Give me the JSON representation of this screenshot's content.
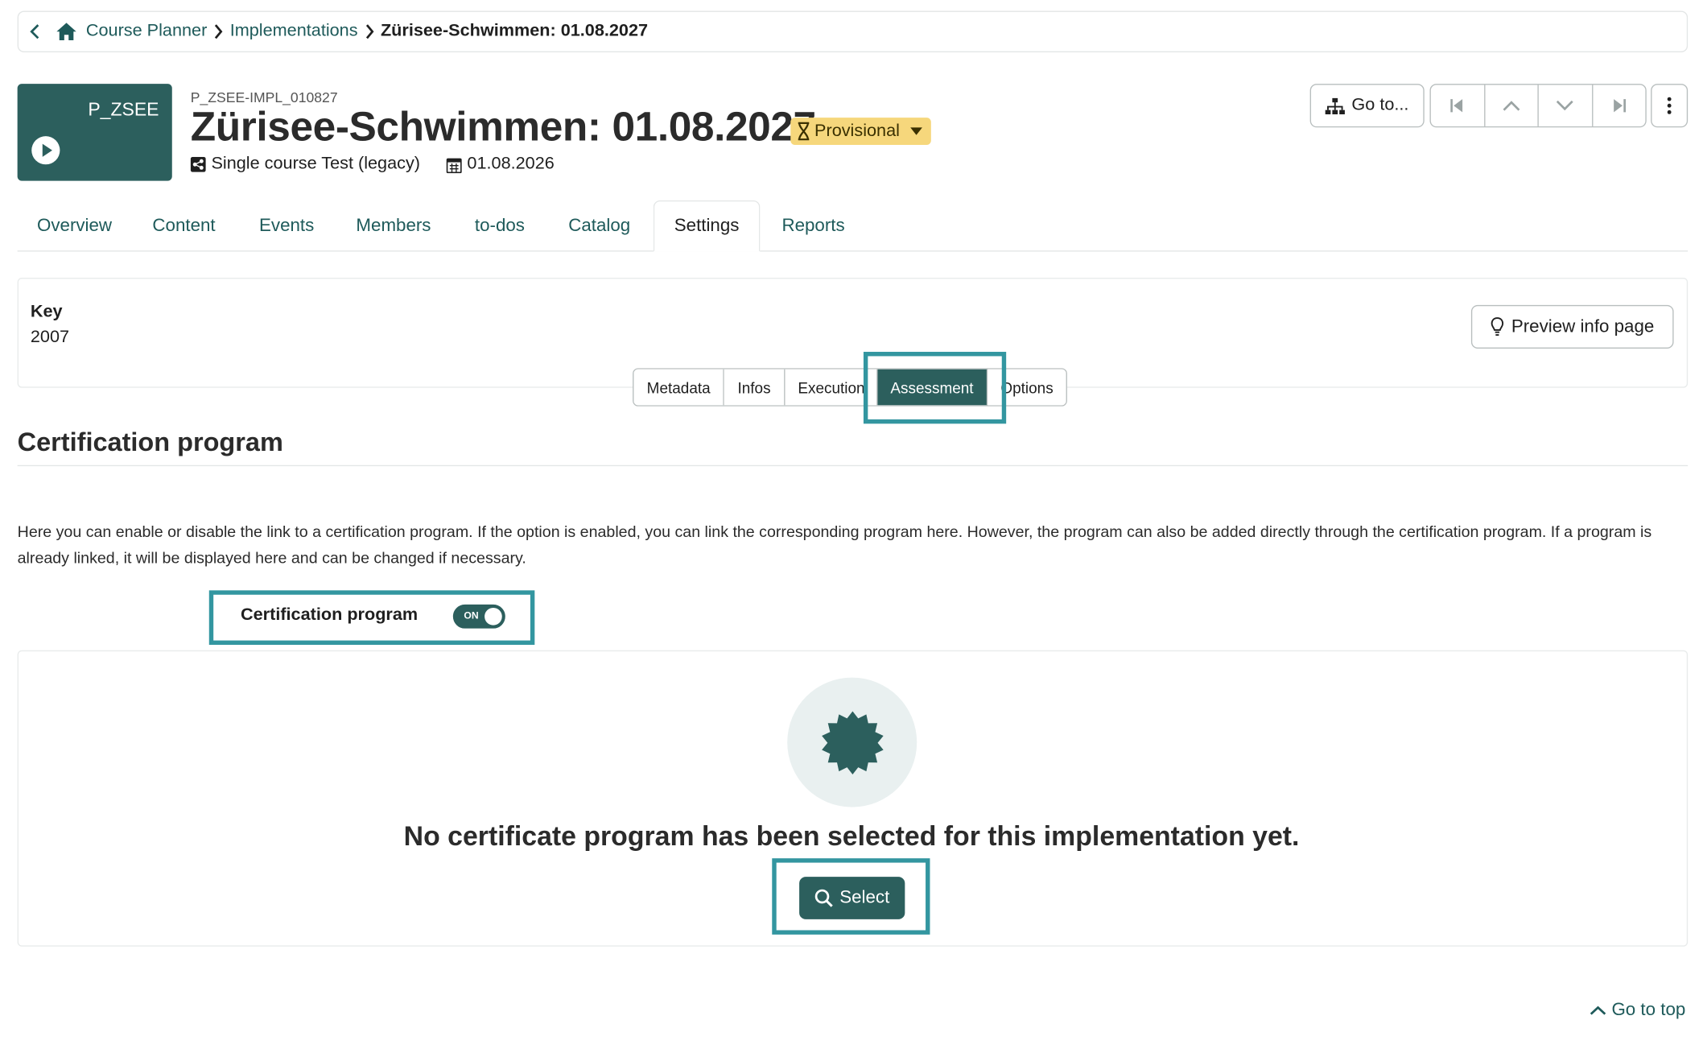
{
  "breadcrumb": {
    "items": [
      "Course Planner",
      "Implementations"
    ],
    "current": "Zürisee-Schwimmen: 01.08.2027"
  },
  "course": {
    "thumb_code": "P_ZSEE",
    "external_id": "P_ZSEE-IMPL_010827",
    "title": "Zürisee-Schwimmen: 01.08.2027",
    "status": "Provisional",
    "type": "Single course Test (legacy)",
    "date": "01.08.2026"
  },
  "toolbar": {
    "goto_label": "Go to..."
  },
  "tabs": [
    {
      "label": "Overview",
      "active": false
    },
    {
      "label": "Content",
      "active": false
    },
    {
      "label": "Events",
      "active": false
    },
    {
      "label": "Members",
      "active": false
    },
    {
      "label": "to-dos",
      "active": false
    },
    {
      "label": "Catalog",
      "active": false
    },
    {
      "label": "Settings",
      "active": true
    },
    {
      "label": "Reports",
      "active": false
    }
  ],
  "key_panel": {
    "label": "Key",
    "value": "2007",
    "preview_label": "Preview info page"
  },
  "subtabs": [
    {
      "label": "Metadata",
      "active": false
    },
    {
      "label": "Infos",
      "active": false
    },
    {
      "label": "Execution",
      "active": false
    },
    {
      "label": "Assessment",
      "active": true
    },
    {
      "label": "Options",
      "active": false
    }
  ],
  "section": {
    "title": "Certification program",
    "description": "Here you can enable or disable the link to a certification program. If the option is enabled, you can link the corresponding program here. However, the program can also be added directly through the certification program. If a program is already linked, it will be displayed here and can be changed if necessary.",
    "toggle_label": "Certification program",
    "toggle_state": "ON"
  },
  "empty_state": {
    "message": "No certificate program has been selected for this implementation yet.",
    "select_label": "Select"
  },
  "footer": {
    "goto_top": "Go to top"
  },
  "colors": {
    "brand": "#2c5f5d",
    "link": "#1e5a5a",
    "highlight": "#3396a0",
    "status": "#f6d77c"
  }
}
